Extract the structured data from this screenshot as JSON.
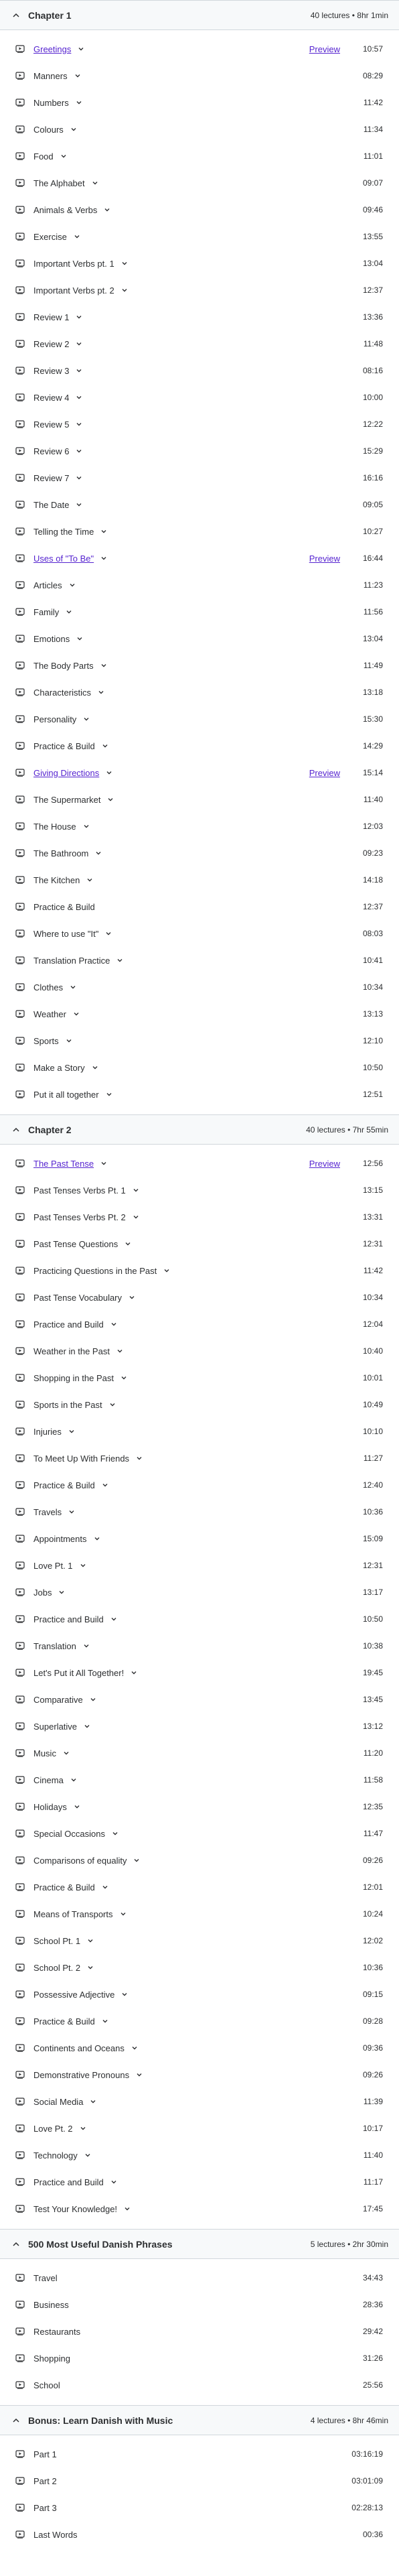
{
  "sections": [
    {
      "title": "Chapter 1",
      "meta": "40 lectures • 8hr 1min",
      "lectures": [
        {
          "title": "Greetings",
          "duration": "10:57",
          "preview": "Preview",
          "link": true
        },
        {
          "title": "Manners",
          "duration": "08:29"
        },
        {
          "title": "Numbers",
          "duration": "11:42"
        },
        {
          "title": "Colours",
          "duration": "11:34"
        },
        {
          "title": "Food",
          "duration": "11:01"
        },
        {
          "title": "The Alphabet",
          "duration": "09:07"
        },
        {
          "title": "Animals & Verbs",
          "duration": "09:46"
        },
        {
          "title": "Exercise",
          "duration": "13:55"
        },
        {
          "title": "Important Verbs pt. 1",
          "duration": "13:04"
        },
        {
          "title": "Important Verbs pt. 2",
          "duration": "12:37"
        },
        {
          "title": "Review 1",
          "duration": "13:36"
        },
        {
          "title": "Review 2",
          "duration": "11:48"
        },
        {
          "title": "Review 3",
          "duration": "08:16"
        },
        {
          "title": "Review 4",
          "duration": "10:00"
        },
        {
          "title": "Review 5",
          "duration": "12:22"
        },
        {
          "title": "Review 6",
          "duration": "15:29"
        },
        {
          "title": "Review 7",
          "duration": "16:16"
        },
        {
          "title": "The Date",
          "duration": "09:05"
        },
        {
          "title": "Telling the Time",
          "duration": "10:27"
        },
        {
          "title": "Uses of \"To Be\"",
          "duration": "16:44",
          "preview": "Preview",
          "link": true
        },
        {
          "title": "Articles",
          "duration": "11:23"
        },
        {
          "title": "Family",
          "duration": "11:56"
        },
        {
          "title": "Emotions",
          "duration": "13:04"
        },
        {
          "title": "The Body Parts",
          "duration": "11:49"
        },
        {
          "title": "Characteristics",
          "duration": "13:18"
        },
        {
          "title": "Personality",
          "duration": "15:30"
        },
        {
          "title": "Practice & Build",
          "duration": "14:29"
        },
        {
          "title": "Giving Directions",
          "duration": "15:14",
          "preview": "Preview",
          "link": true
        },
        {
          "title": "The Supermarket",
          "duration": "11:40"
        },
        {
          "title": "The House",
          "duration": "12:03"
        },
        {
          "title": "The Bathroom",
          "duration": "09:23"
        },
        {
          "title": "The Kitchen",
          "duration": "14:18"
        },
        {
          "title": "Practice & Build",
          "duration": "12:37",
          "nochev": true
        },
        {
          "title": "Where to use \"It\"",
          "duration": "08:03"
        },
        {
          "title": "Translation Practice",
          "duration": "10:41"
        },
        {
          "title": "Clothes",
          "duration": "10:34"
        },
        {
          "title": "Weather",
          "duration": "13:13"
        },
        {
          "title": "Sports",
          "duration": "12:10"
        },
        {
          "title": "Make a Story",
          "duration": "10:50"
        },
        {
          "title": "Put it all together",
          "duration": "12:51"
        }
      ]
    },
    {
      "title": "Chapter 2",
      "meta": "40 lectures • 7hr 55min",
      "lectures": [
        {
          "title": "The Past Tense",
          "duration": "12:56",
          "preview": "Preview",
          "link": true
        },
        {
          "title": "Past Tenses Verbs Pt. 1",
          "duration": "13:15"
        },
        {
          "title": "Past Tenses Verbs Pt. 2",
          "duration": "13:31"
        },
        {
          "title": "Past Tense Questions",
          "duration": "12:31"
        },
        {
          "title": "Practicing Questions in the Past",
          "duration": "11:42"
        },
        {
          "title": "Past Tense Vocabulary",
          "duration": "10:34"
        },
        {
          "title": "Practice and Build",
          "duration": "12:04"
        },
        {
          "title": "Weather in the Past",
          "duration": "10:40"
        },
        {
          "title": "Shopping in the Past",
          "duration": "10:01"
        },
        {
          "title": "Sports in the Past",
          "duration": "10:49"
        },
        {
          "title": "Injuries",
          "duration": "10:10"
        },
        {
          "title": "To Meet Up With Friends",
          "duration": "11:27"
        },
        {
          "title": "Practice & Build",
          "duration": "12:40"
        },
        {
          "title": "Travels",
          "duration": "10:36"
        },
        {
          "title": "Appointments",
          "duration": "15:09"
        },
        {
          "title": "Love Pt. 1",
          "duration": "12:31"
        },
        {
          "title": "Jobs",
          "duration": "13:17"
        },
        {
          "title": "Practice and Build",
          "duration": "10:50"
        },
        {
          "title": "Translation",
          "duration": "10:38"
        },
        {
          "title": "Let's Put it All Together!",
          "duration": "19:45"
        },
        {
          "title": "Comparative",
          "duration": "13:45"
        },
        {
          "title": "Superlative",
          "duration": "13:12"
        },
        {
          "title": "Music",
          "duration": "11:20"
        },
        {
          "title": "Cinema",
          "duration": "11:58"
        },
        {
          "title": "Holidays",
          "duration": "12:35"
        },
        {
          "title": "Special Occasions",
          "duration": "11:47"
        },
        {
          "title": "Comparisons of equality",
          "duration": "09:26"
        },
        {
          "title": "Practice & Build",
          "duration": "12:01"
        },
        {
          "title": "Means of Transports",
          "duration": "10:24"
        },
        {
          "title": "School Pt. 1",
          "duration": "12:02"
        },
        {
          "title": "School Pt. 2",
          "duration": "10:36"
        },
        {
          "title": "Possessive Adjective",
          "duration": "09:15"
        },
        {
          "title": "Practice & Build",
          "duration": "09:28"
        },
        {
          "title": "Continents and Oceans",
          "duration": "09:36"
        },
        {
          "title": "Demonstrative Pronouns",
          "duration": "09:26"
        },
        {
          "title": "Social Media",
          "duration": "11:39"
        },
        {
          "title": "Love Pt. 2",
          "duration": "10:17"
        },
        {
          "title": "Technology",
          "duration": "11:40"
        },
        {
          "title": "Practice and Build",
          "duration": "11:17"
        },
        {
          "title": "Test Your Knowledge!",
          "duration": "17:45"
        }
      ]
    },
    {
      "title": "500 Most Useful Danish Phrases",
      "meta": "5 lectures • 2hr 30min",
      "lectures": [
        {
          "title": "Travel",
          "duration": "34:43",
          "nochev": true
        },
        {
          "title": "Business",
          "duration": "28:36",
          "nochev": true
        },
        {
          "title": "Restaurants",
          "duration": "29:42",
          "nochev": true
        },
        {
          "title": "Shopping",
          "duration": "31:26",
          "nochev": true
        },
        {
          "title": "School",
          "duration": "25:56",
          "nochev": true
        }
      ]
    },
    {
      "title": "Bonus: Learn Danish with Music",
      "meta": "4 lectures • 8hr 46min",
      "lectures": [
        {
          "title": "Part 1",
          "duration": "03:16:19",
          "nochev": true
        },
        {
          "title": "Part 2",
          "duration": "03:01:09",
          "nochev": true
        },
        {
          "title": "Part 3",
          "duration": "02:28:13",
          "nochev": true
        },
        {
          "title": "Last Words",
          "duration": "00:36",
          "nochev": true
        }
      ]
    }
  ],
  "icons": {
    "collapse": "chevron-up-icon",
    "lecture": "video-icon",
    "expand": "chevron-down-icon"
  },
  "colors": {
    "link": "#5624d0",
    "header_bg": "#f7f9fa",
    "text": "#2d2f31"
  }
}
